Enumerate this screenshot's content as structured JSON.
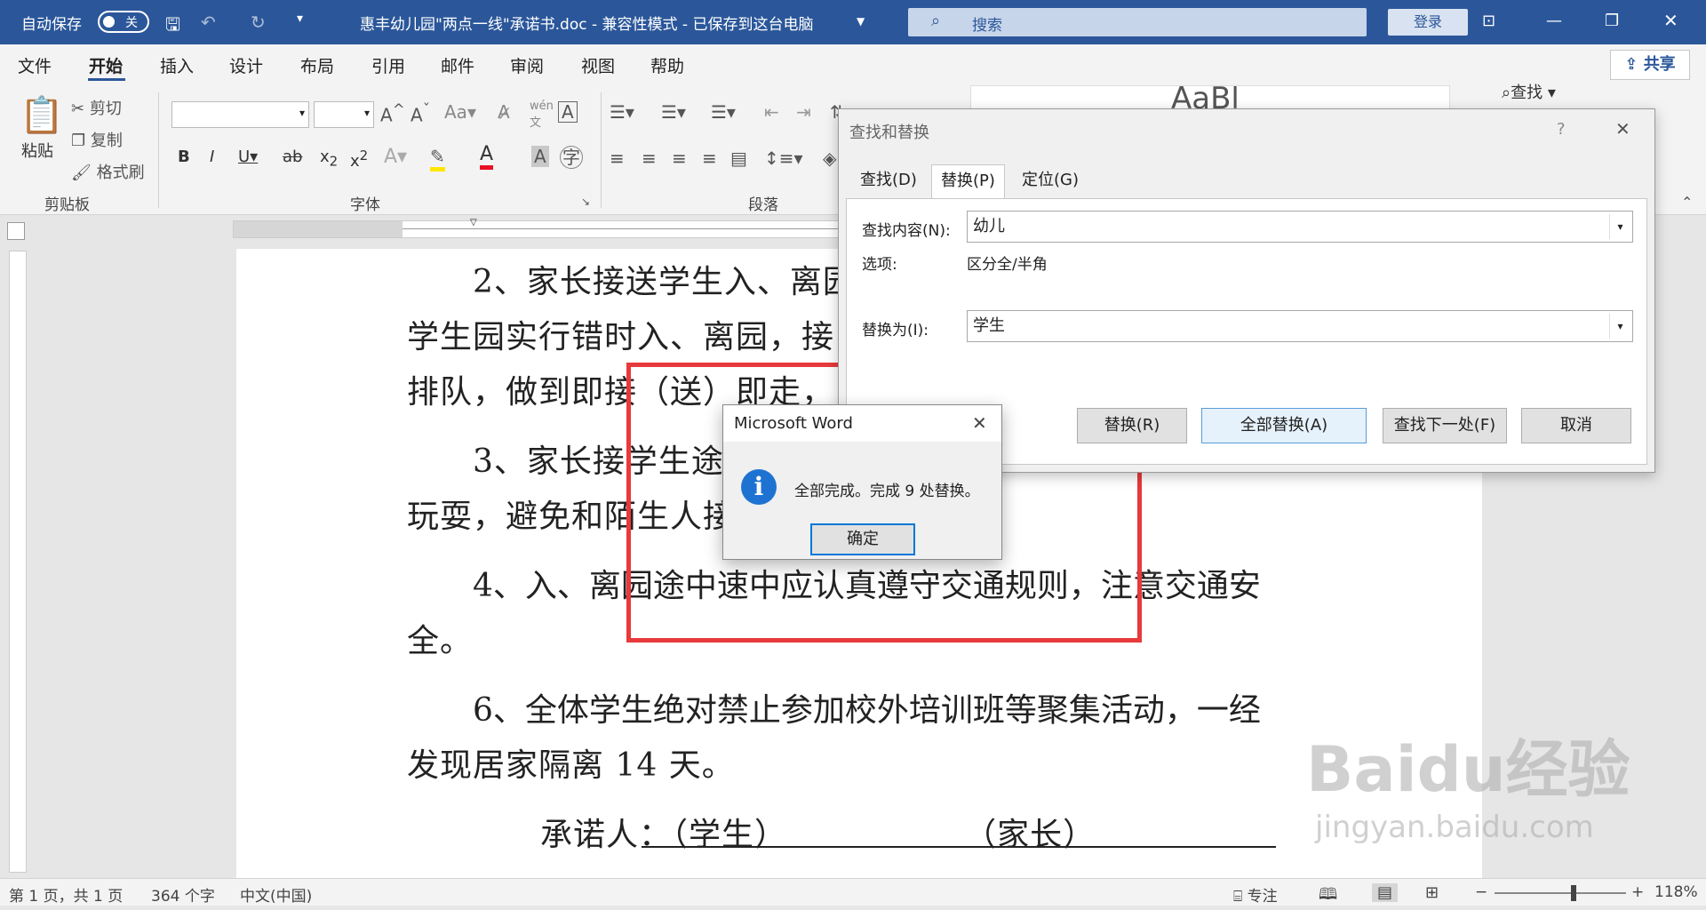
{
  "titlebar": {
    "autosave_label": "自动保存",
    "autosave_state": "关",
    "doc_title": "惠丰幼儿园\"两点一线\"承诺书.doc  -  兼容性模式  -  已保存到这台电脑",
    "search_placeholder": "搜索",
    "login_label": "登录"
  },
  "ribbon": {
    "tabs": [
      "文件",
      "开始",
      "插入",
      "设计",
      "布局",
      "引用",
      "邮件",
      "审阅",
      "视图",
      "帮助"
    ],
    "share_label": "共享",
    "clipboard": {
      "paste": "粘贴",
      "cut": "剪切",
      "copy": "复制",
      "format_painter": "格式刷",
      "group_label": "剪贴板"
    },
    "font_group_label": "字体",
    "paragraph_group_label": "段落",
    "find_label": "查找",
    "styles_preview": "AaBl"
  },
  "document": {
    "paragraphs": [
      "2、家长接送学生入、离园",
      "学生园实行错时入、离园，接",
      "排队，做到即接（送）即走，",
      "3、家长接学生途",
      "玩耍，避免和陌生人接",
      "4、入、离园途中速中应认真遵守交通规则，注意交通安",
      "全。",
      "6、全体学生绝对禁止参加校外培训班等聚集活动，一经",
      "发现居家隔离 14 天。",
      "承诺人：（学生）                （家长）"
    ]
  },
  "find_replace": {
    "title": "查找和替换",
    "help": "?",
    "tabs": [
      "查找(D)",
      "替换(P)",
      "定位(G)"
    ],
    "find_label": "查找内容(N):",
    "find_value": "幼儿",
    "options_label": "选项:",
    "options_value": "区分全/半角",
    "replace_label": "替换为(I):",
    "replace_value": "学生",
    "buttons": {
      "replace": "替换(R)",
      "replace_all": "全部替换(A)",
      "find_next": "查找下一处(F)",
      "cancel": "取消"
    }
  },
  "message_box": {
    "title": "Microsoft Word",
    "text": "全部完成。完成 9 处替换。",
    "ok": "确定",
    "icon": "info-icon"
  },
  "statusbar": {
    "page": "第 1 页，共 1 页",
    "words": "364 个字",
    "language": "中文(中国)",
    "focus": "专注",
    "zoom": "118%",
    "zoom_level": 0.6
  },
  "watermark": {
    "brand": "Baidu经验",
    "url": "jingyan.baidu.com"
  },
  "colors": {
    "accent": "#2b579a",
    "highlight": "#e8393c",
    "info": "#1e73d2"
  }
}
